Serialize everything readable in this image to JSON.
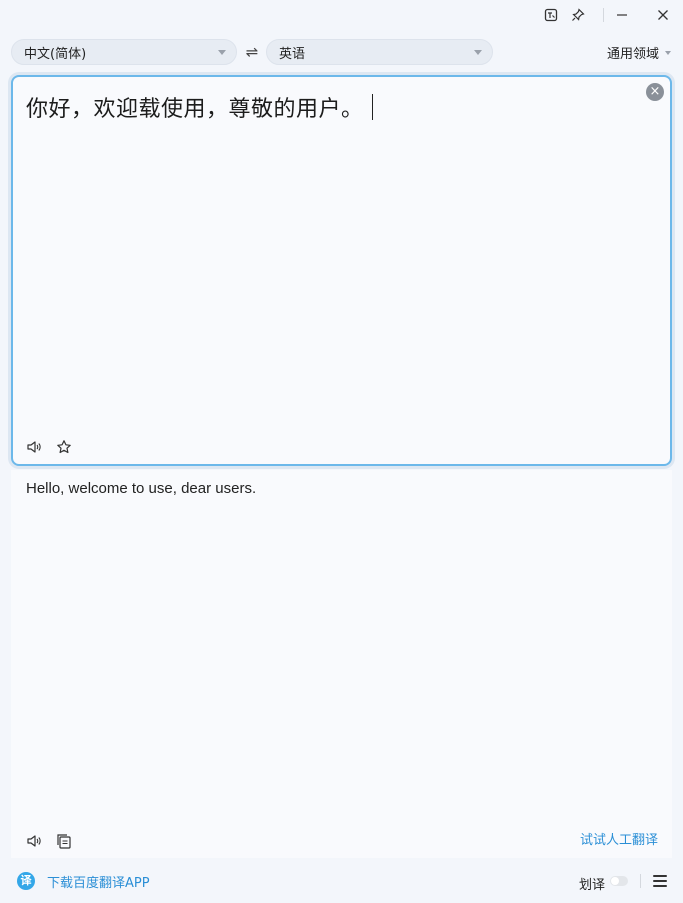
{
  "langbar": {
    "source_lang": "中文(简体)",
    "swap_icon": "⇌",
    "target_lang": "英语",
    "domain": "通用领域"
  },
  "source": {
    "text": "你好，欢迎载使用，尊敬的用户。"
  },
  "result": {
    "text": "Hello, welcome to use, dear users.",
    "human_translate": "试试人工翻译"
  },
  "footer": {
    "app_logo_text": "译",
    "download_app": "下载百度翻译APP",
    "hz_label": "划译"
  },
  "colors": {
    "accent": "#2b8fd6",
    "border": "#6cb8ea"
  },
  "icons": [
    "screenshot-translate-icon",
    "pin-icon",
    "minimize-icon",
    "close-icon",
    "clear-icon",
    "speaker-icon",
    "star-icon",
    "copy-icon",
    "menu-icon"
  ]
}
